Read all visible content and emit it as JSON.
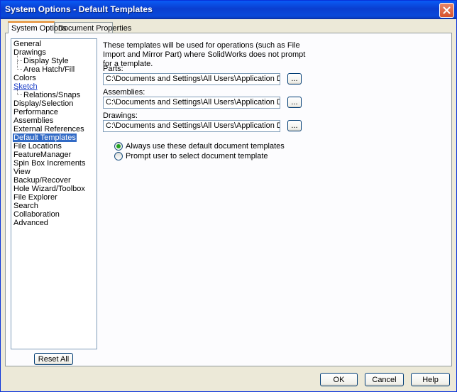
{
  "window": {
    "title": "System Options - Default Templates"
  },
  "tabs": [
    {
      "label": "System Options",
      "active": true
    },
    {
      "label": "Document Properties",
      "active": false
    }
  ],
  "tree": {
    "items": [
      {
        "label": "General",
        "level": 0
      },
      {
        "label": "Drawings",
        "level": 0
      },
      {
        "label": "Display Style",
        "level": 1
      },
      {
        "label": "Area Hatch/Fill",
        "level": 1
      },
      {
        "label": "Colors",
        "level": 0
      },
      {
        "label": "Sketch",
        "level": 0,
        "link": true
      },
      {
        "label": "Relations/Snaps",
        "level": 1
      },
      {
        "label": "Display/Selection",
        "level": 0
      },
      {
        "label": "Performance",
        "level": 0
      },
      {
        "label": "Assemblies",
        "level": 0
      },
      {
        "label": "External References",
        "level": 0
      },
      {
        "label": "Default Templates",
        "level": 0,
        "selected": true
      },
      {
        "label": "File Locations",
        "level": 0
      },
      {
        "label": "FeatureManager",
        "level": 0
      },
      {
        "label": "Spin Box Increments",
        "level": 0
      },
      {
        "label": "View",
        "level": 0
      },
      {
        "label": "Backup/Recover",
        "level": 0
      },
      {
        "label": "Hole Wizard/Toolbox",
        "level": 0
      },
      {
        "label": "File Explorer",
        "level": 0
      },
      {
        "label": "Search",
        "level": 0
      },
      {
        "label": "Collaboration",
        "level": 0
      },
      {
        "label": "Advanced",
        "level": 0
      }
    ],
    "reset_label": "Reset All"
  },
  "content": {
    "description": "These templates will be used for operations (such as File Import and Mirror Part) where SolidWorks does not prompt for a template.",
    "parts": {
      "label": "Parts:",
      "value": "C:\\Documents and Settings\\All Users\\Application Data\\SolidWorks\\SolidWorks"
    },
    "assemblies": {
      "label": "Assemblies:",
      "value": "C:\\Documents and Settings\\All Users\\Application Data\\SolidWorks\\SolidWorks"
    },
    "drawings": {
      "label": "Drawings:",
      "value": "C:\\Documents and Settings\\All Users\\Application Data\\SolidWorks\\SolidWorks"
    },
    "browse_label": "...",
    "radio_options": [
      {
        "label": "Always use these default document templates",
        "checked": true
      },
      {
        "label": "Prompt user to select document template",
        "checked": false
      }
    ]
  },
  "footer": {
    "ok_label": "OK",
    "cancel_label": "Cancel",
    "help_label": "Help"
  },
  "colors": {
    "selection": "#316ac5",
    "title_bar": "#0a49d9",
    "tab_highlight": "#e68b2c"
  }
}
